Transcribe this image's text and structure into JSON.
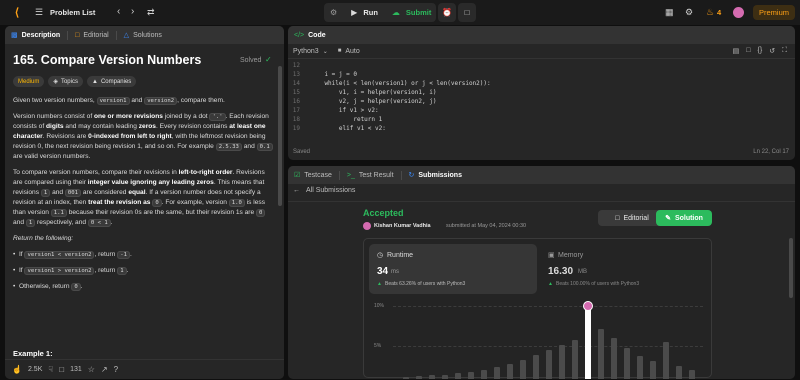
{
  "topbar": {
    "problem_list": "Problem List",
    "run": "Run",
    "submit": "Submit",
    "streak": "4",
    "premium": "Premium"
  },
  "left": {
    "tabs": [
      "Description",
      "Editorial",
      "Solutions"
    ],
    "title": "165. Compare Version Numbers",
    "solved": "Solved",
    "difficulty": "Medium",
    "topics": "Topics",
    "companies": "Companies",
    "footer": {
      "likes": "2.5K",
      "comments": "131"
    },
    "example_heading": "Example 1:",
    "return_following": "Return the following:"
  },
  "code": {
    "header": "Code",
    "language": "Python3",
    "auto": "Auto",
    "saved": "Saved",
    "position": "Ln 22, Col 17",
    "lines": [
      {
        "n": "12",
        "t": ""
      },
      {
        "n": "13",
        "t": "    i = j = 0"
      },
      {
        "n": "14",
        "t": "    while(i < len(version1) or j < len(version2)):"
      },
      {
        "n": "15",
        "t": "        v1, i = helper(version1, i)"
      },
      {
        "n": "16",
        "t": "        v2, j = helper(version2, j)"
      },
      {
        "n": "17",
        "t": "        if v1 > v2:"
      },
      {
        "n": "18",
        "t": "            return 1"
      },
      {
        "n": "19",
        "t": "        elif v1 < v2:"
      }
    ]
  },
  "results": {
    "tabs": [
      "Testcase",
      "Test Result",
      "Submissions"
    ],
    "back": "All Submissions",
    "status": "Accepted",
    "user": "Kishan Kumar Vadhia",
    "submitted": "submitted at May 04, 2024 00:30",
    "editorial": "Editorial",
    "solution": "Solution",
    "runtime_label": "Runtime",
    "runtime_value": "34",
    "runtime_unit": "ms",
    "runtime_beats": "Beats 63.26% of users with Python3",
    "memory_label": "Memory",
    "memory_value": "16.30",
    "memory_unit": "MB",
    "memory_beats": "Beats 100.00% of users with Python3"
  },
  "chart_data": {
    "type": "bar",
    "y_ticks": [
      "10%",
      "5%"
    ],
    "ylim": [
      0,
      10
    ],
    "values": [
      0.3,
      0.4,
      0.5,
      0.6,
      0.8,
      1.0,
      1.3,
      1.6,
      2.0,
      2.6,
      3.3,
      4.0,
      4.6,
      5.3,
      10.0,
      6.8,
      5.6,
      4.2,
      3.2,
      2.4,
      5.0,
      1.8,
      1.2
    ],
    "highlight_index": 14,
    "colors": {
      "bar": "#4b4b4b",
      "highlight": "#ffffff",
      "accent": "#2cbb5d"
    }
  }
}
